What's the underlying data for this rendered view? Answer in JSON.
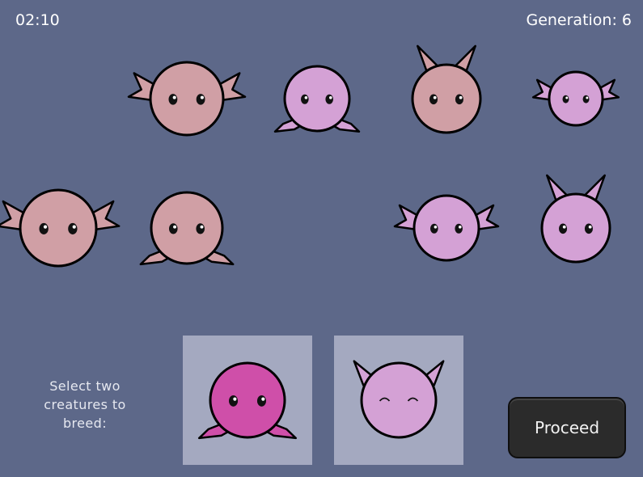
{
  "hud": {
    "timer": "02:10",
    "generation": "Generation: 6"
  },
  "colors": {
    "background": "#5d6889",
    "skin_pink": "#d09fa5",
    "skin_lilac": "#d4a1d5",
    "skin_magenta": "#cf4fa9",
    "slot_background": "#a4a9c0",
    "button_background": "#2b2b2b"
  },
  "population": [
    {
      "ears": "wing-ears",
      "color": "pink",
      "eyes": "open"
    },
    {
      "ears": "legs",
      "color": "lilac",
      "eyes": "open"
    },
    {
      "ears": "bunny-ears",
      "color": "pink",
      "eyes": "open"
    },
    {
      "ears": "wing-ears",
      "color": "lilac",
      "eyes": "open"
    },
    {
      "ears": "wing-ears",
      "color": "pink",
      "eyes": "open"
    },
    {
      "ears": "legs",
      "color": "pink",
      "eyes": "open"
    },
    {
      "ears": "wing-ears",
      "color": "lilac",
      "eyes": "open"
    },
    {
      "ears": "bunny-ears",
      "color": "lilac",
      "eyes": "open"
    }
  ],
  "selection": {
    "prompt": "Select two\ncreatures to\nbreed:",
    "slots": [
      {
        "ears": "legs",
        "color": "magenta",
        "eyes": "open"
      },
      {
        "ears": "horn-ears",
        "color": "lilac",
        "eyes": "closed"
      }
    ]
  },
  "proceed_button": {
    "label": "Proceed"
  }
}
